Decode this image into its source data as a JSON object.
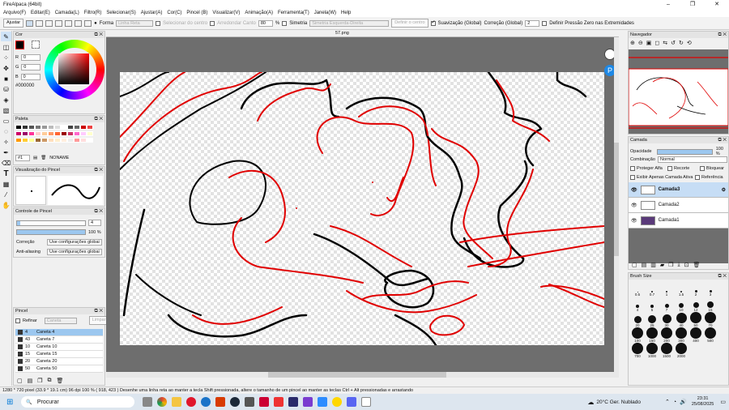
{
  "app": {
    "title": "FireAlpaca (64bit)"
  },
  "menu": [
    "Arquivo(F)",
    "Editar(E)",
    "Camada(L)",
    "Filtro(R)",
    "Selecionar(S)",
    "Ajustar(A)",
    "Cor(C)",
    "Pincel (B)",
    "Visualizar(V)",
    "Animação(A)",
    "Ferramenta(T)",
    "Janela(W)",
    "Help"
  ],
  "toolopts": {
    "adjust": "Ajustar",
    "form": "Forma",
    "form_value": "Linha Reta",
    "select_center": "Selecionar do centro",
    "rounded": "Arredondar Canto",
    "rounded_value": "80",
    "percent": "%",
    "symmetry": "Simetria",
    "symmetry_value": "Simetria Esquerda-Direita",
    "define_center": "Definir o centro",
    "smoothing": "Suavização (Global)",
    "correction": "Correção (Global)",
    "correction_value": "2",
    "pressure": "Definir Pressão Zero nas Extremidades"
  },
  "color_panel": {
    "title": "Cor",
    "r_label": "R",
    "r": "0",
    "g_label": "G",
    "g": "0",
    "b_label": "B",
    "b": "0",
    "hex": "#000000"
  },
  "palette_panel": {
    "title": "Paleta",
    "index": "#1",
    "name": "NONAME"
  },
  "preview_panel": {
    "title": "Visualização do Pincel"
  },
  "brush_control": {
    "title": "Controle de Pincel",
    "size": "4",
    "opacity": "100 %",
    "correction_label": "Correção",
    "correction_value": "Use configurações globai",
    "aa_label": "Anti-aliasing",
    "aa_value": "Use configurações globai"
  },
  "brush_panel": {
    "title": "Pincel",
    "refine": "Refinar",
    "search": "Caneta",
    "clear": "Limpar",
    "items": [
      {
        "size": "4",
        "name": "Caneta 4"
      },
      {
        "size": "43",
        "name": "Caneta 7"
      },
      {
        "size": "10",
        "name": "Caneta 10"
      },
      {
        "size": "15",
        "name": "Caneta 15"
      },
      {
        "size": "20",
        "name": "Caneta 20"
      },
      {
        "size": "50",
        "name": "Caneta 50"
      }
    ]
  },
  "canvas": {
    "tab": "57.png"
  },
  "navigator": {
    "title": "Navegador"
  },
  "layer_panel": {
    "title": "Camada",
    "opacity_label": "Opacidade",
    "opacity": "100 %",
    "blend_label": "Combinação",
    "blend": "Normal",
    "protect_alpha": "Proteger Alfa",
    "clipping": "Recorte",
    "lock": "Bloquear",
    "show_active": "Exibir Apenas Camada Ativa",
    "reference": "Referência",
    "layers": [
      "Camada3",
      "Camada2",
      "Camada1"
    ]
  },
  "brush_size": {
    "title": "Brush Size",
    "sizes": [
      "0.5",
      "0.7",
      "1",
      "1.5",
      "2",
      "3",
      "4",
      "5",
      "7",
      "10",
      "12",
      "15",
      "20",
      "25",
      "30",
      "40",
      "50",
      "70",
      "100",
      "150",
      "200",
      "300",
      "400",
      "500",
      "700",
      "1000",
      "1500",
      "2000"
    ]
  },
  "status": "1280 * 720 pixel  (33.9 * 19.1 cm)  96 dpi  100 %  ( 918, 423 )  Desenhe uma linha reta ao manter a tecla Shift pressionada, altere o tamanho de um pincel ao manter as teclas Ctrl + Alt pressionadas e arrastando",
  "taskbar": {
    "search": "Procurar",
    "weather": "20°C  Ger. Nublado",
    "time": "23:31",
    "date": "25/08/2025"
  },
  "colors": {
    "accent": "#0078d7",
    "stroke_red": "#e00000",
    "stroke_black": "#000000"
  }
}
